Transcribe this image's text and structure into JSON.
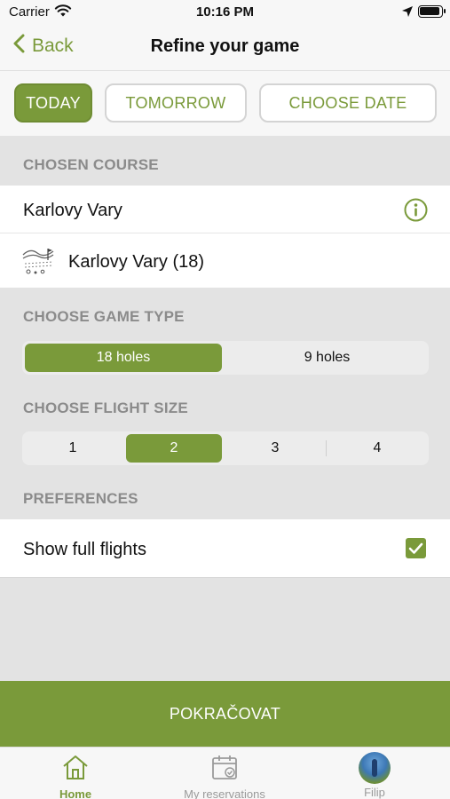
{
  "status_bar": {
    "carrier": "Carrier",
    "time": "10:16 PM"
  },
  "nav": {
    "back_label": "Back",
    "title": "Refine your game"
  },
  "date_options": {
    "today": "TODAY",
    "tomorrow": "TOMORROW",
    "choose_date": "CHOOSE DATE",
    "selected": "TODAY"
  },
  "chosen_course": {
    "header": "CHOSEN COURSE",
    "course_name": "Karlovy Vary",
    "layout_name": "Karlovy Vary (18)"
  },
  "game_type": {
    "header": "CHOOSE GAME TYPE",
    "options": [
      "18 holes",
      "9 holes"
    ],
    "selected": "18 holes"
  },
  "flight_size": {
    "header": "CHOOSE FLIGHT SIZE",
    "options": [
      "1",
      "2",
      "3",
      "4"
    ],
    "selected": "2"
  },
  "preferences": {
    "header": "PREFERENCES",
    "show_full_flights_label": "Show full flights",
    "show_full_flights": true
  },
  "cta": {
    "label": "POKRAČOVAT"
  },
  "tab_bar": {
    "home": "Home",
    "reservations": "My reservations",
    "profile": "Filip",
    "active": "Home"
  },
  "colors": {
    "accent": "#7a9a3a",
    "section_bg": "#e3e3e3",
    "header_text": "#8b8b8b"
  }
}
